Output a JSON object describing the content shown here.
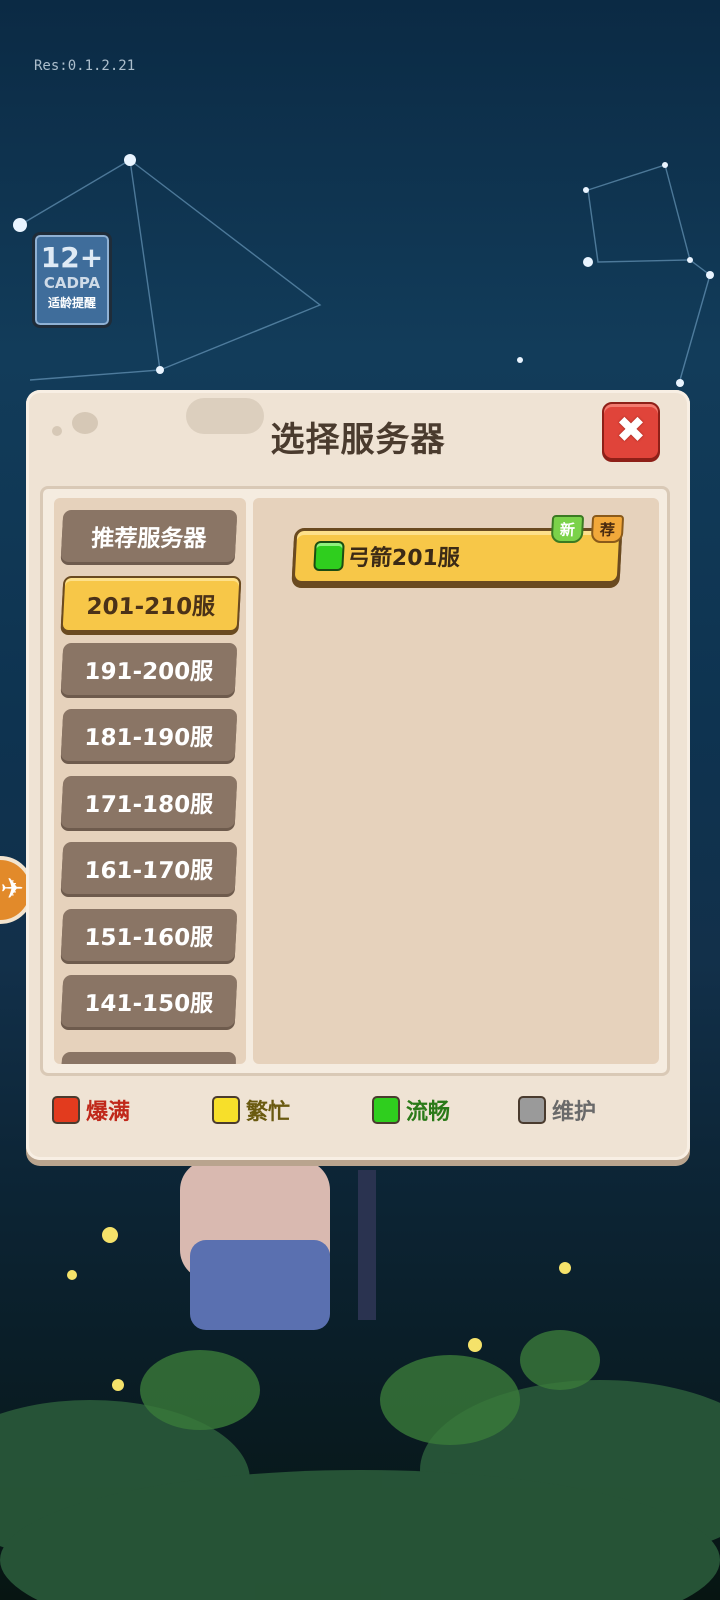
{
  "version_text": "Res:0.1.2.21",
  "age_rating": {
    "age": "12+",
    "org": "CADPA",
    "note": "适龄提醒"
  },
  "dialog": {
    "title": "选择服务器",
    "close_icon": "close-icon"
  },
  "tabs": [
    {
      "label": "推荐服务器",
      "active": false
    },
    {
      "label": "201-210服",
      "active": true
    },
    {
      "label": "191-200服",
      "active": false
    },
    {
      "label": "181-190服",
      "active": false
    },
    {
      "label": "171-180服",
      "active": false
    },
    {
      "label": "161-170服",
      "active": false
    },
    {
      "label": "151-160服",
      "active": false
    },
    {
      "label": "141-150服",
      "active": false
    }
  ],
  "servers": [
    {
      "name": "弓箭201服",
      "status": "流畅",
      "tags": [
        "新",
        "荐"
      ]
    }
  ],
  "legend": [
    {
      "label": "爆满",
      "color": "#e23b1e",
      "text_color": "#c0281a"
    },
    {
      "label": "繁忙",
      "color": "#f7df2a",
      "text_color": "#6a5a10"
    },
    {
      "label": "流畅",
      "color": "#2fce1e",
      "text_color": "#2a7a18"
    },
    {
      "label": "维护",
      "color": "#9a9a9a",
      "text_color": "#6a6a6a"
    }
  ]
}
